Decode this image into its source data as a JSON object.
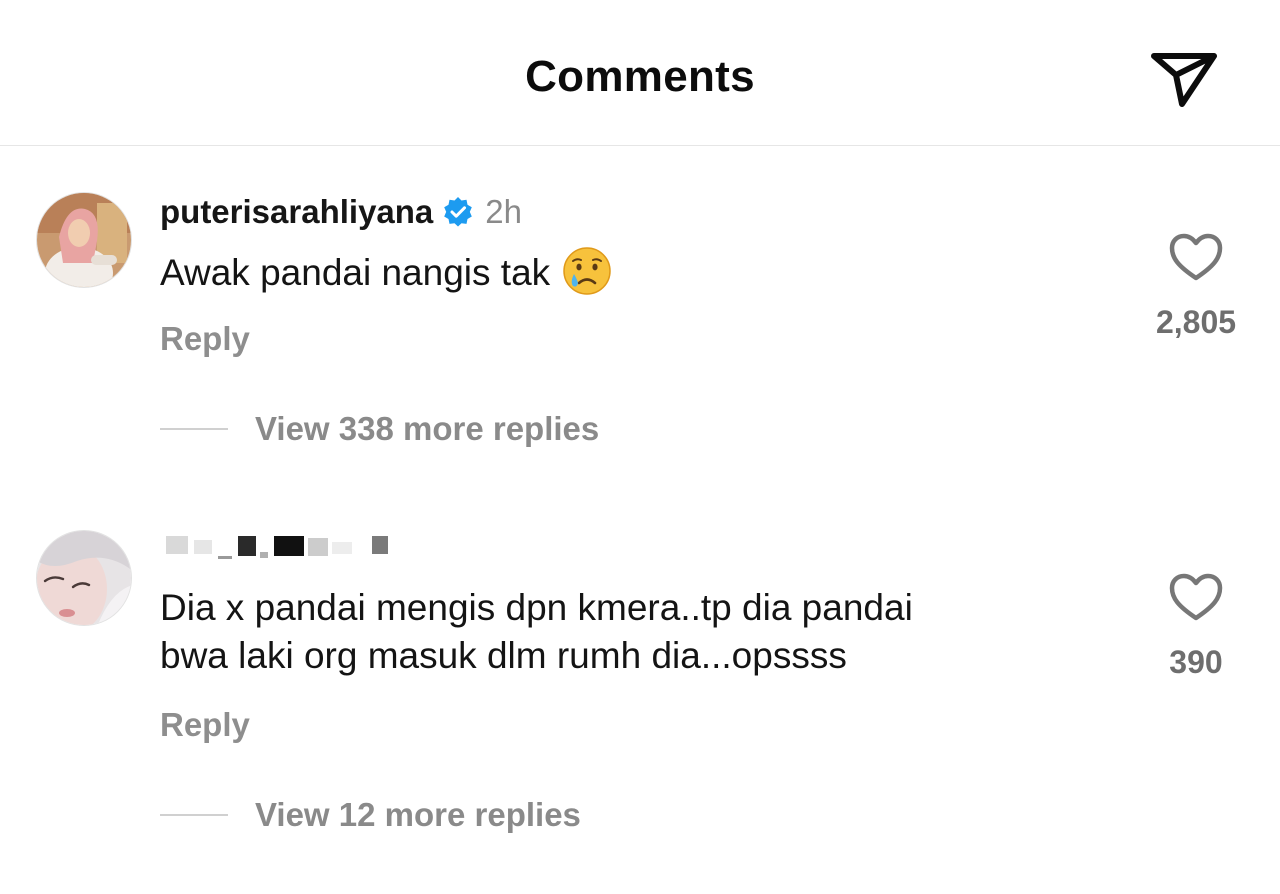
{
  "header": {
    "title": "Comments",
    "share_icon": "paper-plane-icon"
  },
  "comments": [
    {
      "username": "puterisarahliyana",
      "verified": true,
      "timestamp": "2h",
      "text": "Awak pandai nangis tak",
      "emoji": "crying-face-emoji",
      "reply_label": "Reply",
      "like_count": "2,805",
      "view_replies": "View 338 more replies"
    },
    {
      "username_hidden": true,
      "text_line1": "Dia x pandai mengis dpn kmera..tp dia pandai",
      "text_line2": "bwa laki org masuk dlm rumh dia...opssss",
      "reply_label": "Reply",
      "like_count": "390",
      "view_replies": "View 12 more replies"
    }
  ],
  "colors": {
    "verified": "#1d9bf0",
    "muted": "#8e8e8e"
  }
}
